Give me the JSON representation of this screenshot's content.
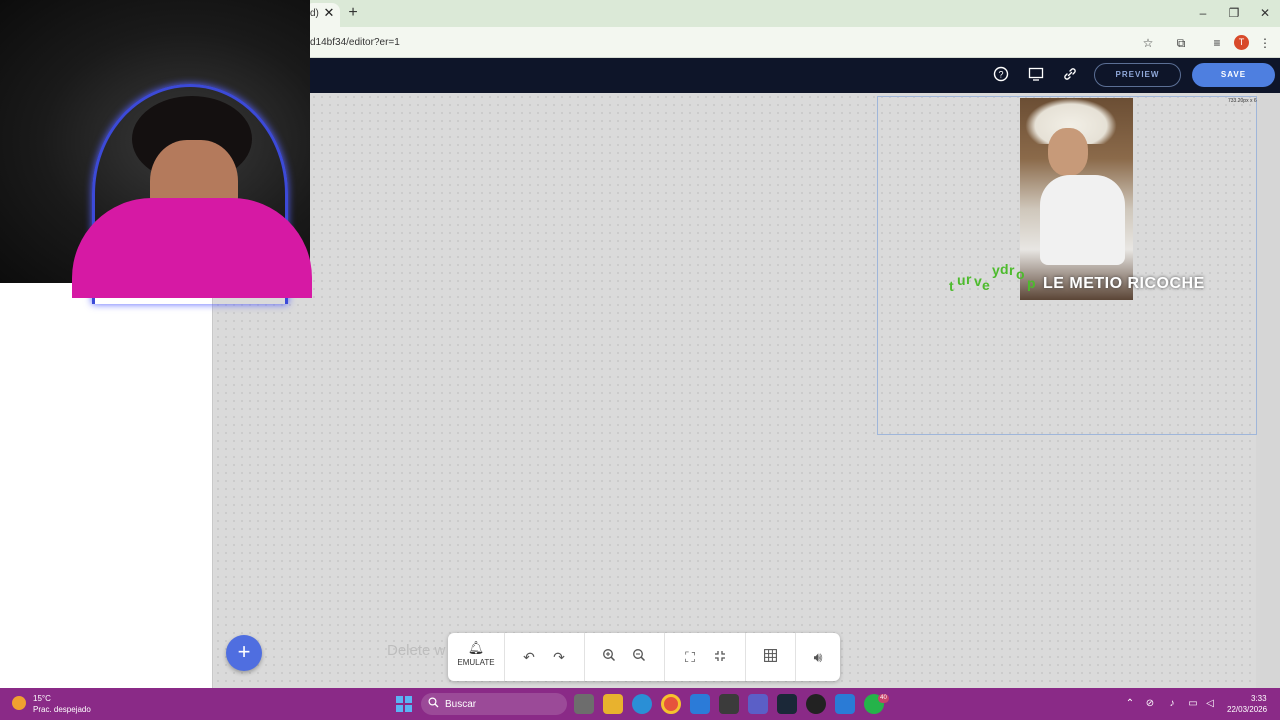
{
  "browser": {
    "tab_fragment": "d)",
    "tab_close": "✕",
    "new_tab": "+",
    "url": "d14bf34/editor?er=1",
    "profile_initial": "T",
    "window_controls": {
      "minimize": "–",
      "restore": "❐",
      "close": "✕"
    }
  },
  "header": {
    "preview_label": "PREVIEW",
    "save_label": "SAVE"
  },
  "canvas": {
    "dimension_label": "733.20px x 6",
    "overlay_text": "LE METIO RICOCHE",
    "curved_text_letters": [
      "t",
      "u",
      "r",
      "v",
      "e",
      "y",
      "d",
      "r",
      "o",
      "p"
    ],
    "ghost_text": "Delete w"
  },
  "toolbar": {
    "emulate_label": "EMULATE"
  },
  "taskbar": {
    "weather_temp": "15°C",
    "weather_condition": "Prac. despejado",
    "search_label": "Buscar",
    "time": "3:33",
    "date": "22/03/2026",
    "notification_count": "40"
  },
  "colors": {
    "app_header": "#0e1529",
    "save_button": "#4e7fe0",
    "fab": "#4f6ee0",
    "taskbar": "#8a2a87",
    "curved_text": "#4dbb2d"
  }
}
